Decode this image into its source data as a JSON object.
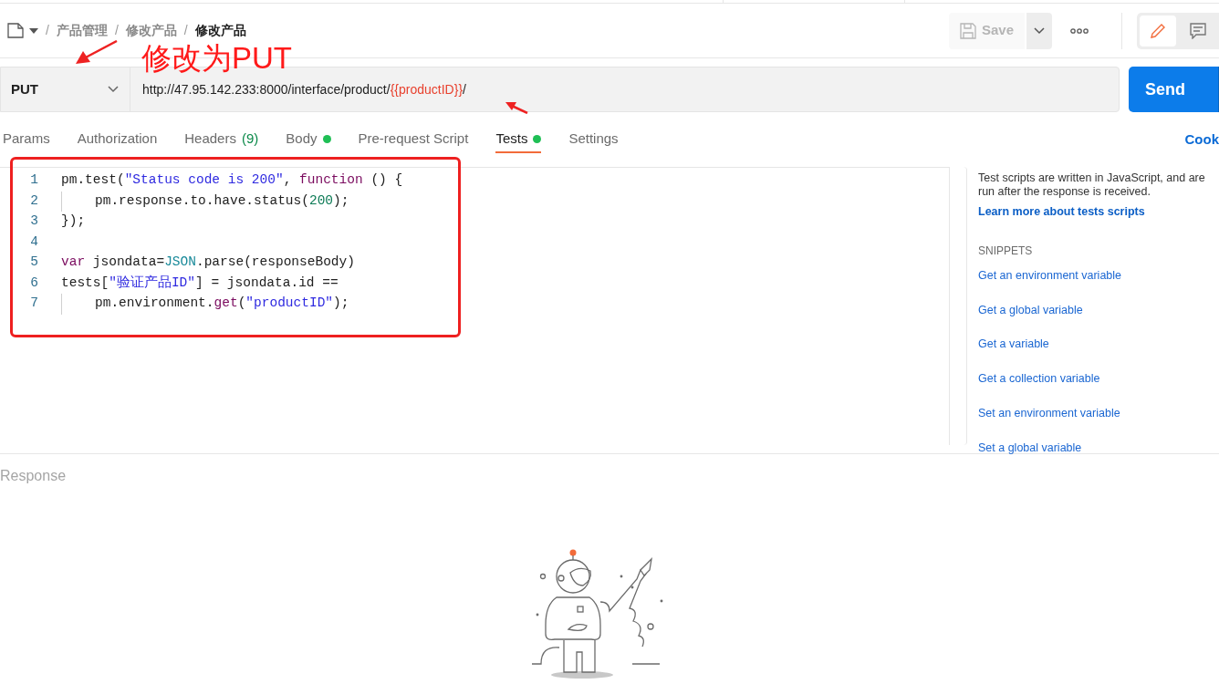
{
  "breadcrumb": [
    {
      "separator": "/",
      "label": "产品管理",
      "current": false
    },
    {
      "separator": "/",
      "label": "修改产品",
      "current": false
    },
    {
      "separator": "/",
      "label": "修改产品",
      "current": true
    }
  ],
  "toolbar": {
    "save": "Save",
    "save_disabled": true,
    "mode_toggle": [
      {
        "kind": "edit",
        "selected": true
      },
      {
        "kind": "comment",
        "selected": false
      }
    ]
  },
  "annotation": {
    "text": "修改为PUT"
  },
  "request": {
    "method": "PUT",
    "url_parts": [
      {
        "text": "http://47.95.142.233:8000/interface/product/",
        "variable": false
      },
      {
        "text": "{{productID}}",
        "variable": true
      },
      {
        "text": "/",
        "variable": false
      }
    ],
    "send": "Send"
  },
  "tabs": [
    {
      "label": "Params",
      "selected": false,
      "dot": false
    },
    {
      "label": "Authorization",
      "selected": false,
      "dot": false
    },
    {
      "label": "Headers",
      "count": "(9)",
      "selected": false,
      "dot": false
    },
    {
      "label": "Body",
      "selected": false,
      "dot": true
    },
    {
      "label": "Pre-request Script",
      "selected": false,
      "dot": false
    },
    {
      "label": "Tests",
      "selected": true,
      "dot": true
    },
    {
      "label": "Settings",
      "selected": false,
      "dot": false
    }
  ],
  "cookies_link": "Cook",
  "editor": {
    "lines": [
      {
        "number": "1",
        "indent": false,
        "tokens": [
          {
            "kind": "plain",
            "text": "pm.test("
          },
          {
            "kind": "string",
            "text": "\"Status code is 200\""
          },
          {
            "kind": "plain",
            "text": ", "
          },
          {
            "kind": "keyword",
            "text": "function"
          },
          {
            "kind": "plain",
            "text": " () {"
          }
        ]
      },
      {
        "number": "2",
        "indent": true,
        "tokens": [
          {
            "kind": "plain",
            "text": "pm.response.to.have.status("
          },
          {
            "kind": "number",
            "text": "200"
          },
          {
            "kind": "plain",
            "text": ");"
          }
        ]
      },
      {
        "number": "3",
        "indent": false,
        "tokens": [
          {
            "kind": "plain",
            "text": "});"
          }
        ]
      },
      {
        "number": "4",
        "indent": false
      },
      {
        "number": "5",
        "indent": false,
        "tokens": [
          {
            "kind": "keyword",
            "text": "var"
          },
          {
            "kind": "plain",
            "text": " jsondata="
          },
          {
            "kind": "builtin",
            "text": "JSON"
          },
          {
            "kind": "plain",
            "text": ".parse(responseBody)"
          }
        ]
      },
      {
        "number": "6",
        "indent": false,
        "tokens": [
          {
            "kind": "plain",
            "text": "tests["
          },
          {
            "kind": "string",
            "text": "\"验证产品ID\""
          },
          {
            "kind": "plain",
            "text": "] = jsondata.id =="
          }
        ]
      },
      {
        "number": "7",
        "indent": true,
        "tokens": [
          {
            "kind": "plain",
            "text": "pm.environment."
          },
          {
            "kind": "keyword",
            "text": "get"
          },
          {
            "kind": "plain",
            "text": "("
          },
          {
            "kind": "string",
            "text": "\"productID\""
          },
          {
            "kind": "plain",
            "text": ");"
          }
        ]
      }
    ]
  },
  "help": {
    "description": "Test scripts are written in JavaScript, and are run after the response is received.",
    "learn_more": "Learn more about tests scripts",
    "snippets_heading": "SNIPPETS",
    "snippets": [
      "Get an environment variable",
      "Get a global variable",
      "Get a variable",
      "Get a collection variable",
      "Set an environment variable",
      "Set a global variable"
    ]
  },
  "response": {
    "title": "Response"
  }
}
